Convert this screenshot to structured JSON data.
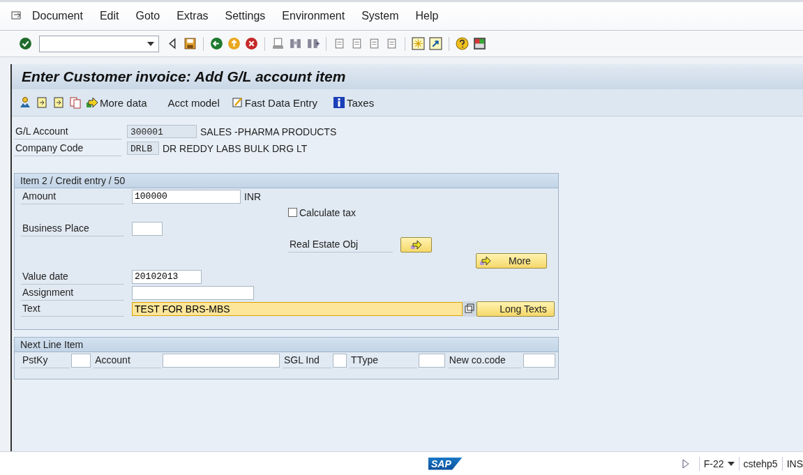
{
  "menu": [
    {
      "label": "Document"
    },
    {
      "label": "Edit"
    },
    {
      "label": "Goto"
    },
    {
      "label": "Extras"
    },
    {
      "label": "Settings"
    },
    {
      "label": "Environment"
    },
    {
      "label": "System"
    },
    {
      "label": "Help"
    }
  ],
  "title": "Enter Customer invoice: Add G/L account item",
  "app_toolbar": [
    {
      "kind": "icon"
    },
    {
      "kind": "icon"
    },
    {
      "kind": "icon"
    },
    {
      "kind": "icon"
    },
    {
      "kind": "arrow",
      "label": "More data"
    },
    {
      "kind": "plain",
      "label": "Acct model"
    },
    {
      "kind": "edit",
      "label": "Fast Data Entry"
    },
    {
      "kind": "info",
      "label": "Taxes"
    }
  ],
  "header_fields": [
    {
      "label": "G/L Account",
      "value": "300001",
      "description": "SALES -PHARMA PRODUCTS"
    },
    {
      "label": "Company Code",
      "value": "DRLB",
      "description": "DR REDDY LABS BULK DRG LT"
    }
  ],
  "item_group": {
    "title": "Item 2 / Credit entry / 50",
    "amount": {
      "label": "Amount",
      "value": "100000",
      "currency": "INR"
    },
    "calculate_tax": {
      "label": "Calculate tax",
      "checked": false
    },
    "business_place": {
      "label": "Business Place"
    },
    "real_estate": {
      "label": "Real Estate Obj"
    },
    "more_button": "More",
    "value_date": {
      "label": "Value date",
      "value": "20102013"
    },
    "assignment": {
      "label": "Assignment"
    },
    "text": {
      "label": "Text",
      "value": "TEST FOR BRS-MBS",
      "focused": true
    },
    "long_texts_button": "Long Texts"
  },
  "next_line_item": {
    "title": "Next Line Item",
    "fields": [
      {
        "label": "PstKy"
      },
      {
        "label": "Account"
      },
      {
        "label": "SGL Ind"
      },
      {
        "label": "TType"
      },
      {
        "label": "New co.code"
      }
    ]
  },
  "status_bar": {
    "logo": "SAP",
    "transaction": "F-22",
    "server": "cstehp5",
    "mode": "INS"
  }
}
